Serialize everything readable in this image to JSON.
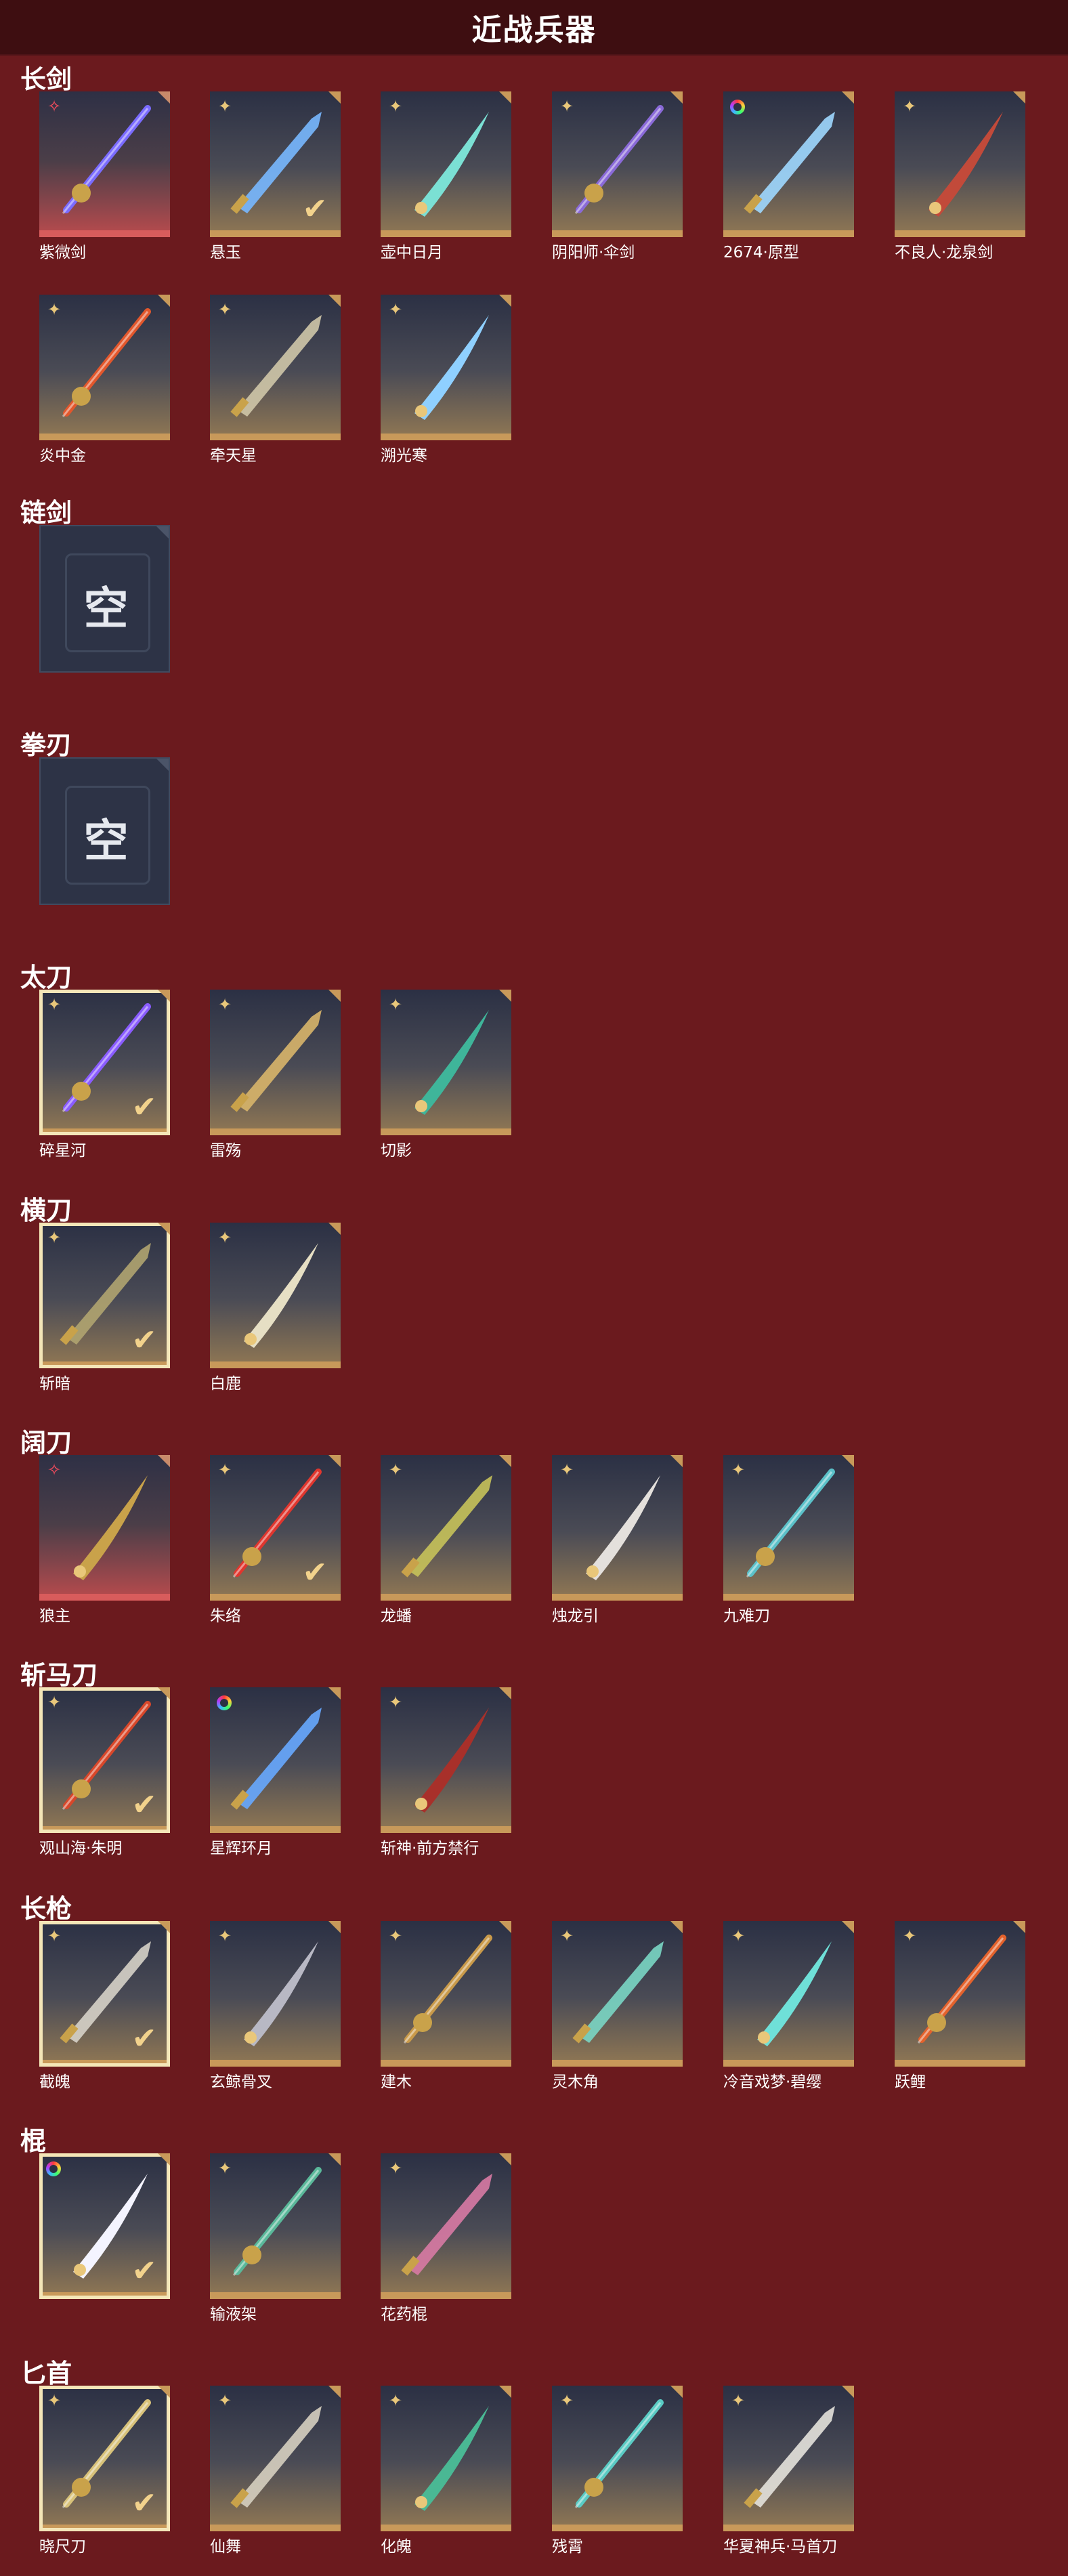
{
  "header": {
    "title": "近战兵器"
  },
  "sections": [
    {
      "name": "长剑",
      "items": [
        {
          "label": "紫微剑",
          "badge": "star",
          "tile": "red",
          "selected": false,
          "check": false,
          "color": "#7a6bff"
        },
        {
          "label": "悬玉",
          "badge": "four",
          "tile": "gold",
          "selected": false,
          "check": true,
          "color": "#78b8ff"
        },
        {
          "label": "壶中日月",
          "badge": "four",
          "tile": "gold",
          "selected": false,
          "check": false,
          "color": "#7be0d4"
        },
        {
          "label": "阴阳师·伞剑",
          "badge": "four",
          "tile": "gold",
          "selected": false,
          "check": false,
          "color": "#8a6ad8"
        },
        {
          "label": "2674·原型",
          "badge": "ring",
          "tile": "gold",
          "selected": false,
          "check": false,
          "color": "#9fd8ff"
        },
        {
          "label": "不良人·龙泉剑",
          "badge": "four",
          "tile": "gold",
          "selected": false,
          "check": false,
          "color": "#c24a3a"
        },
        {
          "label": "炎中金",
          "badge": "four",
          "tile": "gold",
          "selected": false,
          "check": false,
          "color": "#e2572c"
        },
        {
          "label": "牵天星",
          "badge": "four",
          "tile": "gold",
          "selected": false,
          "check": false,
          "color": "#cfc7a8"
        },
        {
          "label": "溯光寒",
          "badge": "four",
          "tile": "gold",
          "selected": false,
          "check": false,
          "color": "#8fd0ff"
        }
      ]
    },
    {
      "name": "链剑",
      "empty_text": "空",
      "items": []
    },
    {
      "name": "拳刃",
      "empty_text": "空",
      "items": []
    },
    {
      "name": "太刀",
      "items": [
        {
          "label": "碎星河",
          "badge": "four",
          "tile": "gold",
          "selected": true,
          "check": true,
          "color": "#8a5cff"
        },
        {
          "label": "雷殇",
          "badge": "four",
          "tile": "gold",
          "selected": false,
          "check": false,
          "color": "#d8b56a"
        },
        {
          "label": "切影",
          "badge": "four",
          "tile": "gold",
          "selected": false,
          "check": false,
          "color": "#3fb59a"
        }
      ]
    },
    {
      "name": "横刀",
      "items": [
        {
          "label": "斩暗",
          "badge": "four",
          "tile": "gold",
          "selected": true,
          "check": true,
          "color": "#b0a470"
        },
        {
          "label": "白鹿",
          "badge": "four",
          "tile": "gold",
          "selected": false,
          "check": false,
          "color": "#e6dfc4"
        }
      ]
    },
    {
      "name": "阔刀",
      "items": [
        {
          "label": "狼主",
          "badge": "star",
          "tile": "red",
          "selected": false,
          "check": false,
          "color": "#c9a24a"
        },
        {
          "label": "朱络",
          "badge": "four",
          "tile": "gold",
          "selected": false,
          "check": true,
          "color": "#e0362e"
        },
        {
          "label": "龙蟠",
          "badge": "four",
          "tile": "gold",
          "selected": false,
          "check": false,
          "color": "#c7c25a"
        },
        {
          "label": "烛龙引",
          "badge": "four",
          "tile": "gold",
          "selected": false,
          "check": false,
          "color": "#e4e0dc"
        },
        {
          "label": "九难刀",
          "badge": "four",
          "tile": "gold",
          "selected": false,
          "check": false,
          "color": "#5bc1c9"
        }
      ]
    },
    {
      "name": "斩马刀",
      "items": [
        {
          "label": "观山海·朱明",
          "badge": "four",
          "tile": "gold",
          "selected": true,
          "check": true,
          "color": "#d8472a"
        },
        {
          "label": "星辉环月",
          "badge": "ring",
          "tile": "gold",
          "selected": false,
          "check": false,
          "color": "#67a9ff"
        },
        {
          "label": "斩神·前方禁行",
          "badge": "four",
          "tile": "gold",
          "selected": false,
          "check": false,
          "color": "#a8302a"
        }
      ]
    },
    {
      "name": "长枪",
      "items": [
        {
          "label": "截魄",
          "badge": "four",
          "tile": "gold",
          "selected": true,
          "check": true,
          "color": "#d6d2c8"
        },
        {
          "label": "玄鲸骨叉",
          "badge": "four",
          "tile": "gold",
          "selected": false,
          "check": false,
          "color": "#b8b8c4"
        },
        {
          "label": "建木",
          "badge": "four",
          "tile": "gold",
          "selected": false,
          "check": false,
          "color": "#c99a4a"
        },
        {
          "label": "灵木角",
          "badge": "four",
          "tile": "gold",
          "selected": false,
          "check": false,
          "color": "#7ad6c4"
        },
        {
          "label": "冷音戏梦·碧缨",
          "badge": "four",
          "tile": "gold",
          "selected": false,
          "check": false,
          "color": "#6fe0d8"
        },
        {
          "label": "跃鲤",
          "badge": "four",
          "tile": "gold",
          "selected": false,
          "check": false,
          "color": "#e4622c"
        }
      ]
    },
    {
      "name": "棍",
      "items": [
        {
          "label": "",
          "badge": "ring",
          "tile": "gold",
          "selected": true,
          "check": true,
          "color": "#f4f4ff"
        },
        {
          "label": "输液架",
          "badge": "four",
          "tile": "gold",
          "selected": false,
          "check": false,
          "color": "#5ab89a"
        },
        {
          "label": "花药棍",
          "badge": "four",
          "tile": "gold",
          "selected": false,
          "check": false,
          "color": "#d87aa4"
        }
      ]
    },
    {
      "name": "匕首",
      "items": [
        {
          "label": "晓尺刀",
          "badge": "four",
          "tile": "gold",
          "selected": true,
          "check": true,
          "color": "#d8c27a"
        },
        {
          "label": "仙舞",
          "badge": "four",
          "tile": "gold",
          "selected": false,
          "check": false,
          "color": "#d6cfc0"
        },
        {
          "label": "化魄",
          "badge": "four",
          "tile": "gold",
          "selected": false,
          "check": false,
          "color": "#4ab894"
        },
        {
          "label": "残霄",
          "badge": "four",
          "tile": "gold",
          "selected": false,
          "check": false,
          "color": "#5acbc4"
        },
        {
          "label": "华夏神兵·马首刀",
          "badge": "four",
          "tile": "gold",
          "selected": false,
          "check": false,
          "color": "#e4e2dc"
        }
      ]
    }
  ]
}
